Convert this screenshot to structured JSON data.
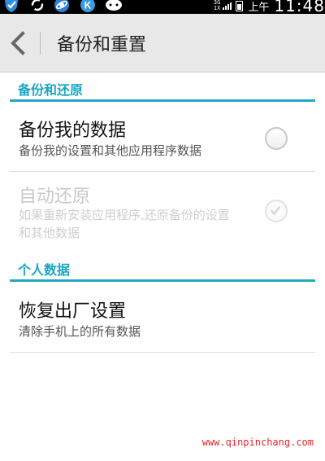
{
  "status_bar": {
    "icons": [
      "shield-check-icon",
      "sync-icon",
      "browser-icon",
      "k-app-icon",
      "chat-icon"
    ],
    "network_top": "3G",
    "network_bottom": "1X",
    "ampm": "上午",
    "time": "11:48"
  },
  "action_bar": {
    "title": "备份和重置",
    "back_icon": "chevron-left-icon"
  },
  "sections": [
    {
      "header": "备份和还原",
      "items": [
        {
          "title": "备份我的数据",
          "summary": "备份我的设置和其他应用程序数据",
          "checked": false,
          "enabled": true
        },
        {
          "title": "自动还原",
          "summary": "如果重新安装应用程序,还原备份的设置和其他数据",
          "checked": true,
          "enabled": false
        }
      ]
    },
    {
      "header": "个人数据",
      "items": [
        {
          "title": "恢复出厂设置",
          "summary": "清除手机上的所有数据"
        }
      ]
    }
  ],
  "watermark": "www.qinpinchang.com",
  "colors": {
    "accent": "#23a8c3",
    "header_text": "#1aa6c4",
    "watermark": "#e8232a"
  }
}
